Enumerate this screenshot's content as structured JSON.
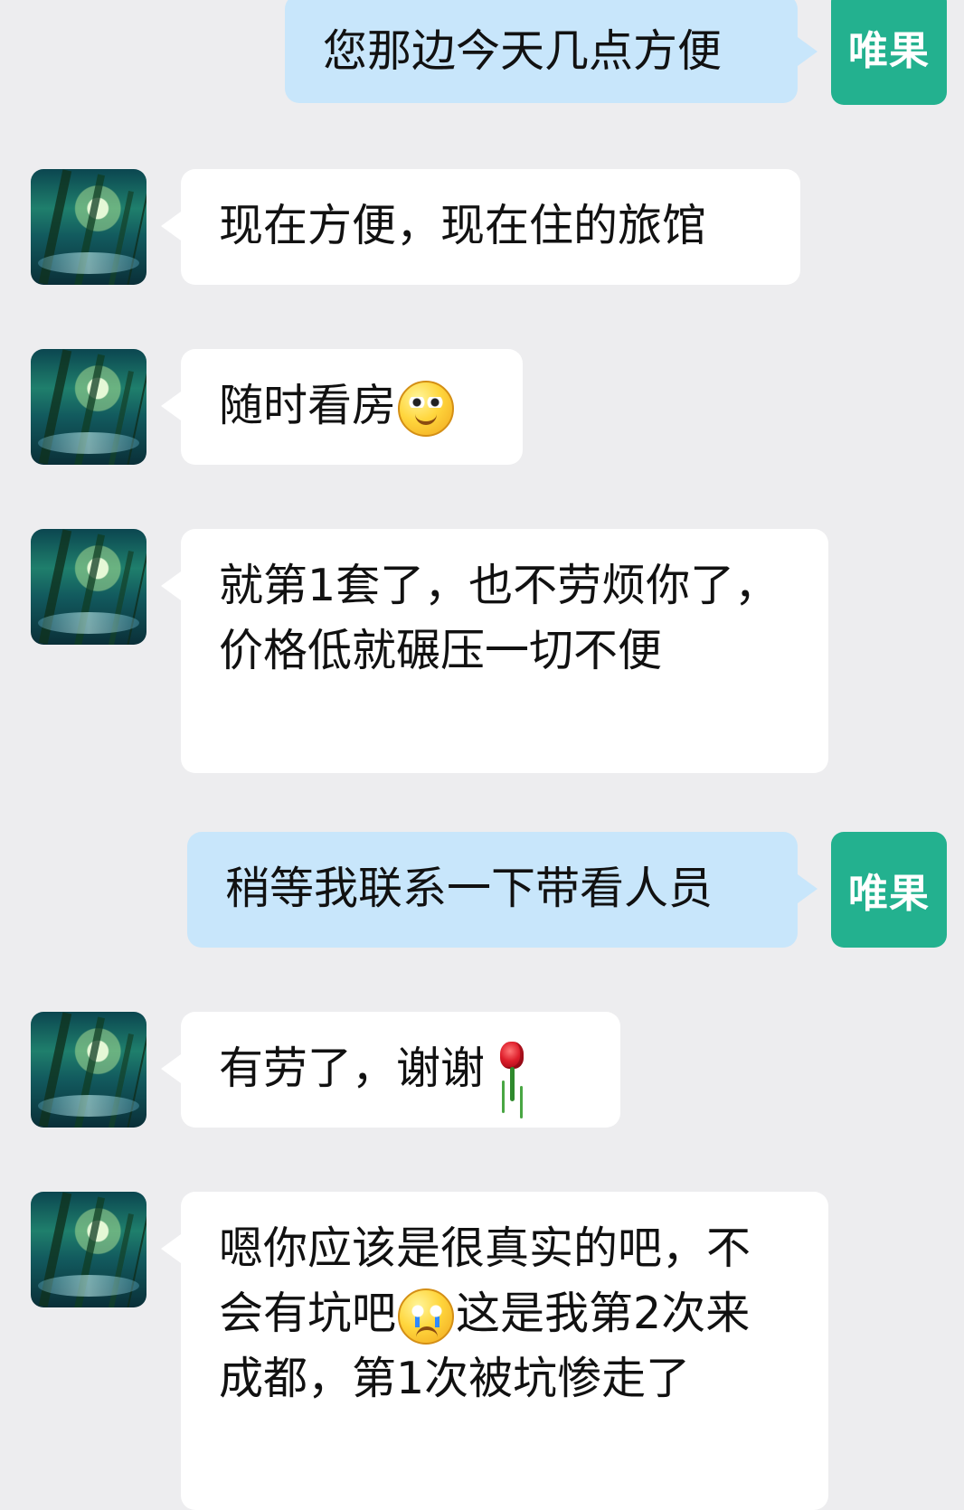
{
  "messages": [
    {
      "id": "m1",
      "sender": "right",
      "avatar_label": "唯果",
      "text": "您那边今天几点方便",
      "emoji": ""
    },
    {
      "id": "m2",
      "sender": "left",
      "avatar_icon": "forest-stream-avatar-icon",
      "text": "现在方便，现在住的旅馆",
      "emoji": ""
    },
    {
      "id": "m3",
      "sender": "left",
      "avatar_icon": "forest-stream-avatar-icon",
      "text": "随时看房",
      "emoji": "smile-emoji"
    },
    {
      "id": "m4",
      "sender": "left",
      "avatar_icon": "forest-stream-avatar-icon",
      "text": "就第1套了，也不劳烦你了，价格低就碾压一切不便",
      "emoji": ""
    },
    {
      "id": "m5",
      "sender": "right",
      "avatar_label": "唯果",
      "text": "稍等我联系一下带看人员",
      "emoji": ""
    },
    {
      "id": "m6",
      "sender": "left",
      "avatar_icon": "forest-stream-avatar-icon",
      "text": "有劳了，谢谢",
      "emoji": "rose-emoji"
    },
    {
      "id": "m7",
      "sender": "left",
      "avatar_icon": "forest-stream-avatar-icon",
      "text_before_emoji": "嗯你应该是很真实的吧，不会有坑吧",
      "emoji": "crying-face-emoji",
      "text_after_emoji": "这是我第2次来成都，第1次被坑惨走了"
    }
  ],
  "colors": {
    "background": "#ededef",
    "incoming_bubble": "#ffffff",
    "outgoing_bubble": "#c8e6fb",
    "outgoing_avatar": "#23b18f"
  }
}
